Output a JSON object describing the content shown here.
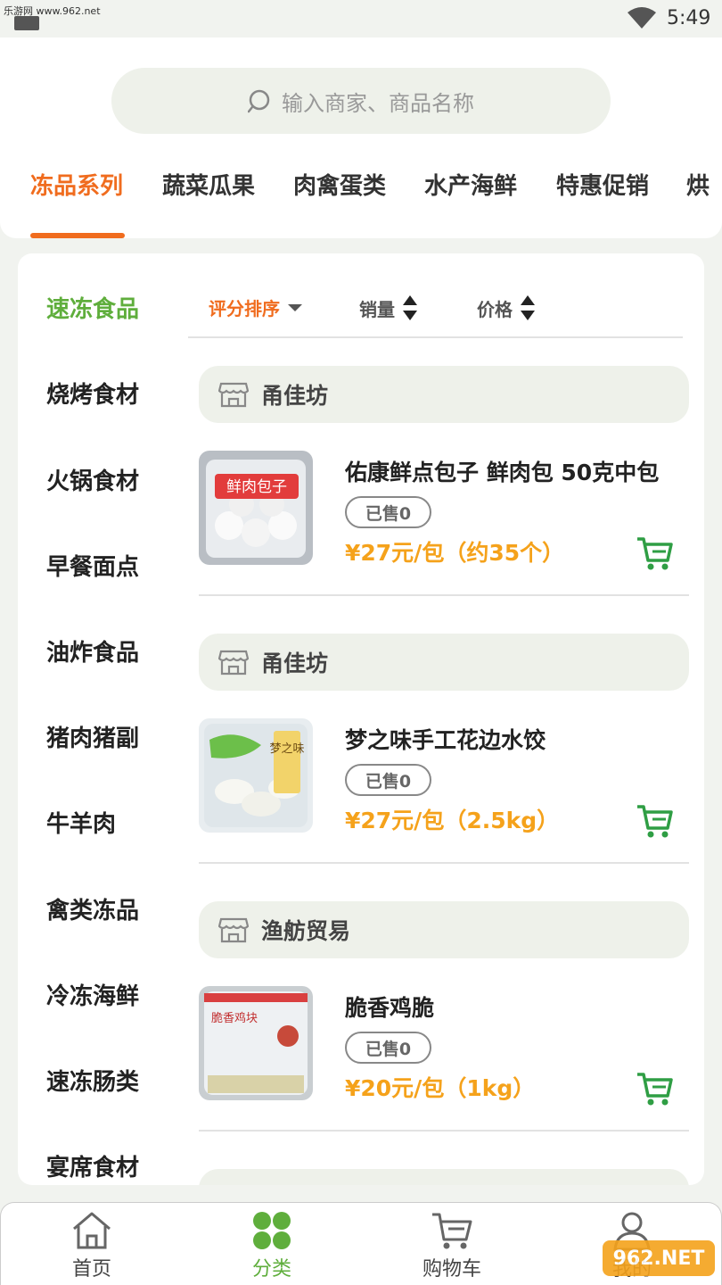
{
  "status_bar": {
    "watermark": "乐游网 www.962.net",
    "time": "5:49"
  },
  "search": {
    "placeholder": "输入商家、商品名称"
  },
  "top_tabs": [
    {
      "label": "冻品系列",
      "active": true
    },
    {
      "label": "蔬菜瓜果",
      "active": false
    },
    {
      "label": "肉禽蛋类",
      "active": false
    },
    {
      "label": "水产海鲜",
      "active": false
    },
    {
      "label": "特惠促销",
      "active": false
    },
    {
      "label": "烘",
      "active": false
    }
  ],
  "categories": [
    {
      "label": "速冻食品",
      "active": true
    },
    {
      "label": "烧烤食材"
    },
    {
      "label": "火锅食材"
    },
    {
      "label": "早餐面点"
    },
    {
      "label": "油炸食品"
    },
    {
      "label": "猪肉猪副"
    },
    {
      "label": "牛羊肉"
    },
    {
      "label": "禽类冻品"
    },
    {
      "label": "冷冻海鲜"
    },
    {
      "label": "速冻肠类"
    },
    {
      "label": "宴席食材"
    }
  ],
  "sort": {
    "rating": "评分排序",
    "sales": "销量",
    "price": "价格"
  },
  "products": [
    {
      "shop": "甬佳坊",
      "name": "佑康鲜点包子 鲜肉包 50克中包",
      "sold": "已售0",
      "price": "¥27元/包（约35个）",
      "image_text": "鲜肉包子"
    },
    {
      "shop": "甬佳坊",
      "name": "梦之味手工花边水饺",
      "sold": "已售0",
      "price": "¥27元/包（2.5kg）",
      "image_text": "梦之味"
    },
    {
      "shop": "渔舫贸易",
      "name": "脆香鸡脆",
      "sold": "已售0",
      "price": "¥20元/包（1kg）",
      "image_text": "脆香鸡块"
    }
  ],
  "bottom_nav": [
    {
      "label": "首页",
      "icon": "home-icon"
    },
    {
      "label": "分类",
      "icon": "clover-icon",
      "active": true
    },
    {
      "label": "购物车",
      "icon": "cart-icon"
    },
    {
      "label": "我的",
      "icon": "user-icon"
    }
  ],
  "watermark_br": "962.NET",
  "colors": {
    "accent_orange": "#f06c1e",
    "green": "#5fae3c",
    "price": "#f5a21b",
    "bg": "#f1f3ef"
  }
}
